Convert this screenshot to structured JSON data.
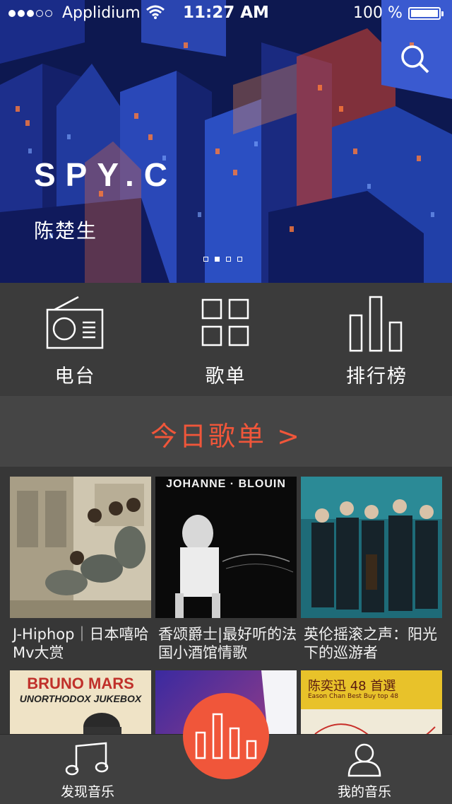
{
  "status_bar": {
    "carrier": "Applidium",
    "time": "11:27 AM",
    "battery": "100 %"
  },
  "hero": {
    "title": "SPY.C",
    "subtitle": "陈楚生",
    "page_count": 4,
    "active_page": 2
  },
  "categories": [
    {
      "label": "电台",
      "icon": "radio-icon"
    },
    {
      "label": "歌单",
      "icon": "grid-icon"
    },
    {
      "label": "排行榜",
      "icon": "chart-bars-icon"
    }
  ],
  "today": {
    "label": "今日歌单 >"
  },
  "playlists": [
    {
      "caption": "J-Hiphop｜日本嘻哈Mv大赏"
    },
    {
      "caption": "香颂爵士|最好听的法国小酒馆情歌",
      "cover_text": "JOHANNE · BLOUIN"
    },
    {
      "caption": "英伦摇滚之声：阳光下的巡游者"
    },
    {
      "caption": "",
      "cover_text": "BRUNO MARS",
      "cover_subtext": "UNORTHODOX JUKEBOX"
    },
    {
      "caption": ""
    },
    {
      "caption": "",
      "cover_text": "陈奕迅 48 首選",
      "cover_subtext": "Eason Chan Best Buy top 48"
    }
  ],
  "tabs": [
    {
      "label": "发现音乐",
      "icon": "music-note-icon"
    },
    {
      "label": "我的音乐",
      "icon": "user-icon"
    }
  ],
  "colors": {
    "accent": "#f0563a",
    "background": "#3a3a3a"
  }
}
